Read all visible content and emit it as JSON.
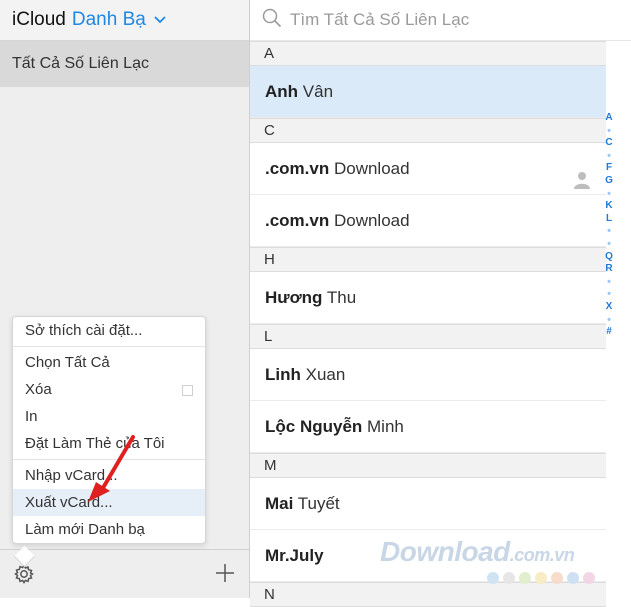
{
  "sidebar": {
    "app_name": "iCloud",
    "section_name": "Danh Bạ",
    "group_label": "Tất Cả Số Liên Lạc"
  },
  "menu": {
    "items": [
      "Sở thích cài đặt...",
      "Chọn Tất Cả",
      "Xóa",
      "In",
      "Đặt Làm Thẻ của Tôi",
      "Nhập vCard...",
      "Xuất vCard...",
      "Làm mới Danh bạ"
    ],
    "active_item": "Xuất vCard..."
  },
  "search": {
    "placeholder": "Tìm Tất Cả Số Liên Lạc"
  },
  "contacts": {
    "sections": [
      {
        "letter": "A",
        "rows": [
          {
            "bold": "Anh",
            "rest": " Vân",
            "selected": true
          }
        ]
      },
      {
        "letter": "C",
        "rows": [
          {
            "bold": ".com.vn",
            "rest": " Download",
            "icon": "person-icon"
          },
          {
            "bold": ".com.vn",
            "rest": " Download"
          }
        ]
      },
      {
        "letter": "H",
        "rows": [
          {
            "bold": "Hương",
            "rest": " Thu"
          }
        ]
      },
      {
        "letter": "L",
        "rows": [
          {
            "bold": "Linh",
            "rest": " Xuan"
          },
          {
            "bold": "Lộc Nguyễn",
            "rest": " Minh"
          }
        ]
      },
      {
        "letter": "M",
        "rows": [
          {
            "bold": "Mai",
            "rest": " Tuyết"
          },
          {
            "bold": "Mr.July",
            "rest": ""
          }
        ]
      },
      {
        "letter": "N",
        "rows": []
      }
    ]
  },
  "index_letters": [
    "A",
    "•",
    "C",
    "•",
    "F",
    "G",
    "•",
    "K",
    "L",
    "•",
    "•",
    "Q",
    "R",
    "•",
    "•",
    "X",
    "•",
    "#"
  ],
  "watermark": {
    "text": "Download",
    "suffix": ".com.vn"
  },
  "colors": {
    "accent": "#1e88e5",
    "arrow": "#e02020",
    "selected_row": "#daeaf8"
  }
}
